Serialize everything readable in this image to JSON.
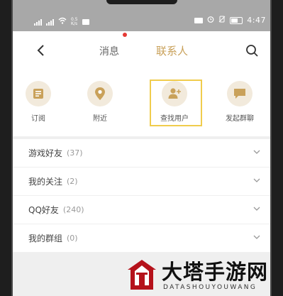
{
  "status_bar": {
    "network_left": "4G",
    "speed_text": "0.5\nK/s",
    "time": "4:47"
  },
  "nav": {
    "tab_messages": "消息",
    "tab_contacts": "联系人",
    "active_tab": "联系人",
    "unread_dot_color": "#e53935",
    "accent_color": "#c9a15a"
  },
  "shortcuts": [
    {
      "label": "订阅",
      "icon": "subscribe-icon"
    },
    {
      "label": "附近",
      "icon": "location-pin-icon"
    },
    {
      "label": "查找用户",
      "icon": "add-user-icon",
      "highlighted": true
    },
    {
      "label": "发起群聊",
      "icon": "group-chat-icon"
    }
  ],
  "groups": [
    {
      "title": "游戏好友",
      "count": "(37)"
    },
    {
      "title": "我的关注",
      "count": "(2)"
    },
    {
      "title": "QQ好友",
      "count": "(240)"
    },
    {
      "title": "我的群组",
      "count": "(0)"
    }
  ],
  "watermark": {
    "title": "大塔手游网",
    "subtitle": "DATASHOUYOUWANG"
  }
}
